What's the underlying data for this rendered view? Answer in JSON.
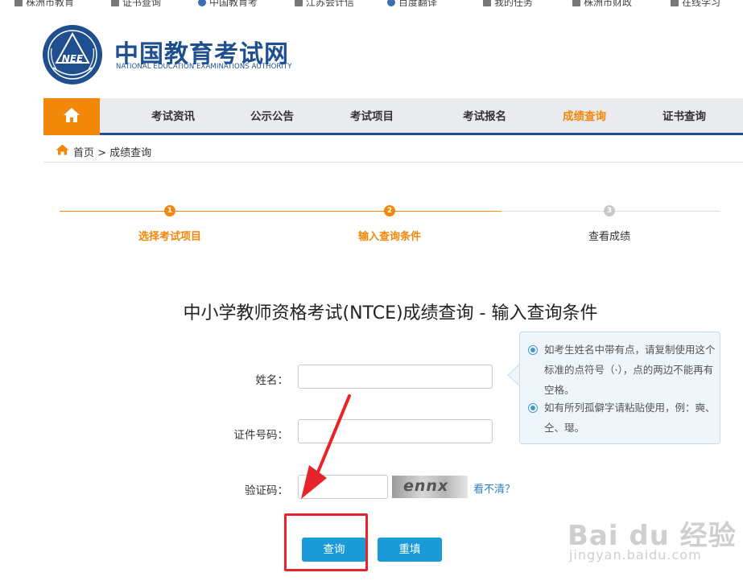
{
  "colors": {
    "accent": "#f2880a",
    "brand": "#1f4f8f",
    "button": "#1a9bd7",
    "annotation": "#e5242b"
  },
  "bookmarks": [
    "株洲市教育",
    "证书查询",
    "中国教育考",
    "江苏会计信",
    "百度翻译",
    "我的任务",
    "株洲市财政",
    "在线学习"
  ],
  "logo": {
    "cn": "中国教育考试网",
    "en": "NATIONAL EDUCATION EXAMINATIONS AUTHORITY",
    "emblem_text": "NEEA"
  },
  "nav": {
    "home_icon": "home-icon",
    "items": [
      "考试资讯",
      "公示公告",
      "考试项目",
      "考试报名",
      "成绩查询",
      "证书查询"
    ],
    "active_index": 4
  },
  "breadcrumb": {
    "text": "首页 > 成绩查询"
  },
  "steps": [
    {
      "num": "1",
      "label": "选择考试项目",
      "done": true
    },
    {
      "num": "2",
      "label": "输入查询条件",
      "done": true
    },
    {
      "num": "3",
      "label": "查看成绩",
      "done": false
    }
  ],
  "title": "中小学教师资格考试(NTCE)成绩查询 - 输入查询条件",
  "form": {
    "name_label": "姓名：",
    "id_label": "证件号码：",
    "captcha_label": "验证码：",
    "name_value": "",
    "id_value": "",
    "captcha_value": "",
    "captcha_image_text": "ennx",
    "refresh_link": "看不清？"
  },
  "tips": [
    "如考生姓名中带有点，请复制使用这个标准的点符号（·），点的两边不能再有空格。",
    "如有所列孤僻字请粘贴使用，例：奭、仝、璱。"
  ],
  "buttons": {
    "query": "查询",
    "reset": "重填"
  },
  "watermark": {
    "main": "Bai du 经验",
    "sub": "jingyan.baidu.com"
  }
}
